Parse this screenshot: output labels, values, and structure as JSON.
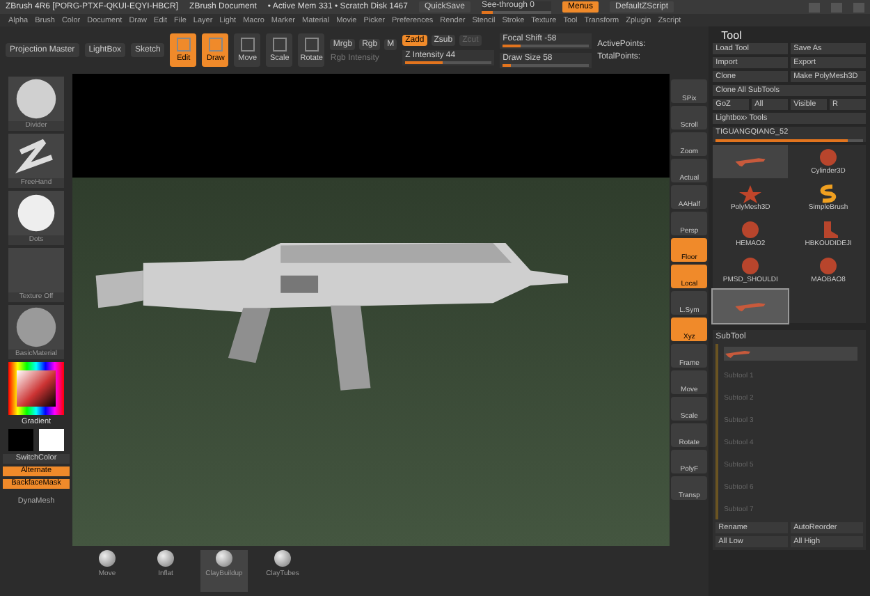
{
  "title_bar": {
    "items": [
      "ZBrush 4R6 [PORG-PTXF-QKUI-EQYI-HBCR]",
      "ZBrush Document",
      "• Active Mem 331 • Scratch Disk 1467"
    ],
    "quicksave": "QuickSave",
    "see_through": {
      "label": "See-through 0",
      "level": 0
    },
    "menus": {
      "label": "Menus",
      "selected": true
    },
    "script": "DefaultZScript"
  },
  "menu_bar": [
    "Alpha",
    "Brush",
    "Color",
    "Document",
    "Draw",
    "Edit",
    "File",
    "Layer",
    "Light",
    "Macro",
    "Marker",
    "Material",
    "Movie",
    "Picker",
    "Preferences",
    "Render",
    "Stencil",
    "Stroke",
    "Texture",
    "Tool",
    "Transform",
    "Zplugin",
    "Zscript"
  ],
  "toolbar": {
    "buttons": [
      "Projection Master",
      "LightBox",
      "Sketch"
    ],
    "modes": [
      {
        "label": "Edit",
        "selected": true
      },
      {
        "label": "Draw",
        "selected": true
      },
      {
        "label": "Move",
        "selected": false
      },
      {
        "label": "Scale",
        "selected": false
      },
      {
        "label": "Rotate",
        "selected": false
      }
    ],
    "color_modes": [
      "Mrgb",
      "Rgb",
      "M"
    ],
    "rgb_intensity": {
      "label": "Rgb Intensity",
      "disabled": true
    },
    "z_modes": [
      {
        "label": "Zadd",
        "selected": true,
        "disabled": false
      },
      {
        "label": "Zsub",
        "selected": false,
        "disabled": false
      },
      {
        "label": "Zcut",
        "selected": false,
        "disabled": true
      }
    ],
    "sliders": [
      {
        "label": "Z Intensity 44",
        "level": 0.44
      },
      {
        "label": "Focal Shift -58",
        "level": 0.21
      },
      {
        "label": "Draw Size 58",
        "level": 0.1
      }
    ],
    "points": [
      "ActivePoints:",
      "TotalPoints:"
    ]
  },
  "left_shelf": {
    "brushes": [
      {
        "label": "Divider",
        "kind": "sphere"
      },
      {
        "label": "FreeHand",
        "kind": "stroke"
      },
      {
        "label": "Dots",
        "kind": "disc"
      },
      {
        "label": "Texture Off",
        "kind": "empty"
      },
      {
        "label": "BasicMaterial",
        "kind": "material"
      }
    ],
    "gradient": "Gradient",
    "switch_color": "SwitchColor",
    "toggles": [
      {
        "label": "Alternate",
        "on": true
      },
      {
        "label": "BackfaceMask",
        "on": true
      }
    ],
    "dynamesh": "DynaMesh"
  },
  "right_shelf": [
    {
      "label": "SPix",
      "on": false
    },
    {
      "label": "Scroll",
      "on": false
    },
    {
      "label": "Zoom",
      "on": false
    },
    {
      "label": "Actual",
      "on": false
    },
    {
      "label": "AAHalf",
      "on": false
    },
    {
      "label": "Persp",
      "on": false
    },
    {
      "label": "Floor",
      "on": true
    },
    {
      "label": "Local",
      "on": true
    },
    {
      "label": "L.Sym",
      "on": false
    },
    {
      "label": "Xyz",
      "on": true
    },
    {
      "label": "Frame",
      "on": false
    },
    {
      "label": "Move",
      "on": false
    },
    {
      "label": "Scale",
      "on": false
    },
    {
      "label": "Rotate",
      "on": false
    },
    {
      "label": "PolyF",
      "on": false
    },
    {
      "label": "Transp",
      "on": false
    }
  ],
  "tool_panel": {
    "title": "Tool",
    "button_rows": [
      [
        "Load Tool",
        "Save As"
      ],
      [
        "Import",
        "Export"
      ],
      [
        "Clone",
        "Make PolyMesh3D"
      ],
      [
        "Clone All SubTools"
      ],
      [
        "GoZ",
        "All",
        "Visible",
        "R"
      ],
      [
        "Lightbox› Tools"
      ]
    ],
    "current_tool": {
      "label": "TIGUANGQIANG_52",
      "level": 0.9
    },
    "thumbnails": [
      {
        "kind": "gun",
        "selected": false
      },
      {
        "label": "Cylinder3D",
        "kind": "ball",
        "selected": false
      },
      {
        "label": "PolyMesh3D",
        "kind": "star",
        "selected": false
      },
      {
        "label": "SimpleBrush",
        "kind": "brush",
        "selected": false
      },
      {
        "label": "HEMAO2",
        "kind": "ball",
        "selected": false
      },
      {
        "label": "HBKOUDIDEJI",
        "kind": "boot",
        "selected": false
      },
      {
        "label": "PMSD_SHOULDI",
        "kind": "ball",
        "selected": false
      },
      {
        "label": "MAOBAO8",
        "kind": "ball",
        "selected": false
      },
      {
        "kind": "gun",
        "selected": true
      }
    ],
    "subtool": {
      "title": "SubTool",
      "items": [
        {
          "selected": true
        },
        {
          "label": "Subtool 1",
          "selected": false
        },
        {
          "label": "Subtool 2",
          "selected": false
        },
        {
          "label": "Subtool 3",
          "selected": false
        },
        {
          "label": "Subtool 4",
          "selected": false
        },
        {
          "label": "Subtool 5",
          "selected": false
        },
        {
          "label": "Subtool 6",
          "selected": false
        },
        {
          "label": "Subtool 7",
          "selected": false
        }
      ],
      "buttons": [
        "Rename",
        "AutoReorder",
        "All Low",
        "All High"
      ]
    }
  },
  "bottom_shelf": [
    {
      "label": "Move",
      "selected": false
    },
    {
      "label": "Inflat",
      "selected": false
    },
    {
      "label": "ClayBuildup",
      "selected": true
    },
    {
      "label": "ClayTubes",
      "selected": false
    }
  ]
}
